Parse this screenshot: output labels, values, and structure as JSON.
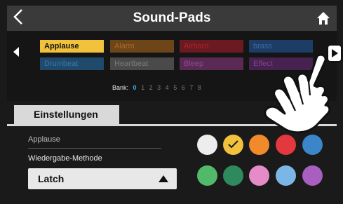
{
  "header": {
    "title": "Sound-Pads",
    "back_icon": "chevron-left-icon",
    "home_icon": "home-icon"
  },
  "pads": [
    {
      "label": "Applause",
      "color": "#f2c23c",
      "active": true
    },
    {
      "label": "Alarm",
      "color": "#6e4518",
      "active": false
    },
    {
      "label": "Airhorn",
      "color": "#6a1a20",
      "active": false
    },
    {
      "label": "brass",
      "color": "#1e3d66",
      "active": false
    },
    {
      "label": "Drumbeat",
      "color": "#1f4a6b",
      "active": false
    },
    {
      "label": "Heartbeat",
      "color": "#4a4a4a",
      "active": false
    },
    {
      "label": "Bleep",
      "color": "#5a2a55",
      "active": false
    },
    {
      "label": "Effect",
      "color": "#47214f",
      "active": false
    }
  ],
  "bank": {
    "label": "Bank:",
    "numbers": [
      "0",
      "1",
      "2",
      "3",
      "4",
      "5",
      "6",
      "7",
      "8"
    ],
    "selected": "0"
  },
  "tabs": {
    "settings": "Einstellungen"
  },
  "settings": {
    "pad_name": "Applause",
    "method_label": "Wiedergabe-Methode",
    "method_value": "Latch"
  },
  "colors": [
    {
      "name": "white",
      "hex": "#ededed",
      "selected": false
    },
    {
      "name": "yellow",
      "hex": "#f2c23c",
      "selected": true
    },
    {
      "name": "orange",
      "hex": "#f08a2a",
      "selected": false
    },
    {
      "name": "red",
      "hex": "#e2383e",
      "selected": false
    },
    {
      "name": "blue",
      "hex": "#3a86c8",
      "selected": false
    },
    {
      "name": "green",
      "hex": "#52b96a",
      "selected": false
    },
    {
      "name": "dark-green",
      "hex": "#2e8a5c",
      "selected": false
    },
    {
      "name": "pink",
      "hex": "#e48bc8",
      "selected": false
    },
    {
      "name": "light-blue",
      "hex": "#7cb6e6",
      "selected": false
    },
    {
      "name": "purple",
      "hex": "#a85fbf",
      "selected": false
    }
  ],
  "navigation": {
    "prev_icon": "triangle-left-icon",
    "next_icon": "triangle-right-icon"
  },
  "overlay": {
    "icon": "pointing-hand-icon"
  }
}
